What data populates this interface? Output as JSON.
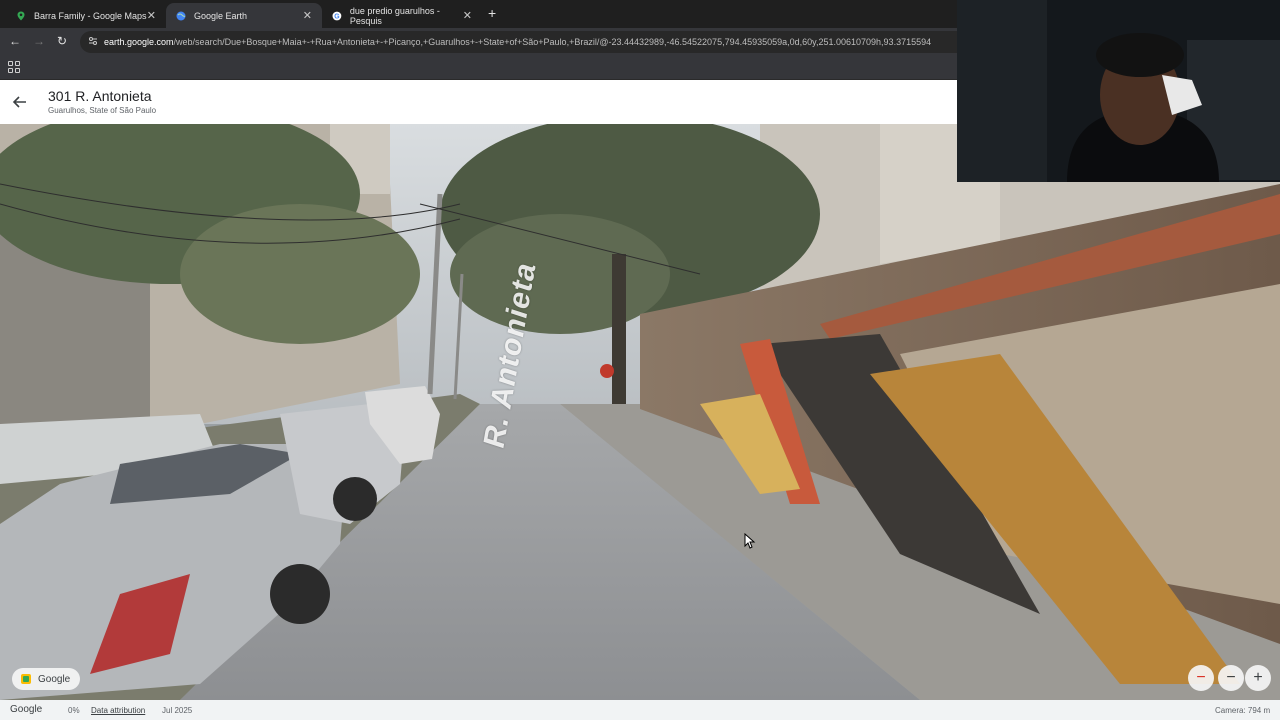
{
  "browser": {
    "tabs": [
      {
        "label": "Barra Family - Google Maps",
        "icon": "maps-pin-icon",
        "active": false
      },
      {
        "label": "Google Earth",
        "icon": "earth-globe-icon",
        "active": true
      },
      {
        "label": "due predio guarulhos - Pesquis",
        "icon": "google-g-icon",
        "active": false
      }
    ],
    "url_host": "earth.google.com",
    "url_path": "/web/search/Due+Bosque+Maia+-+Rua+Antonieta+-+Picanço,+Guarulhos+-+State+of+São+Paulo,+Brazil/@-23.44432989,-46.54522075,794.45935059a,0d,60y,251.00610709h,93.3715594"
  },
  "place": {
    "title": "301 R. Antonieta",
    "subtitle": "Guarulhos, State of São Paulo"
  },
  "streetview": {
    "street_label": "R. Antonieta",
    "google_chip": "Google"
  },
  "statusbar": {
    "brand": "Google",
    "progress": "0%",
    "attribution": "Data attribution",
    "date": "Jul 2025",
    "camera": "Camera: 794 m"
  },
  "colors": {
    "chrome_dark": "#1f1f1f",
    "chrome_toolbar": "#35363a",
    "accent_zoom_out": "#d93025"
  }
}
